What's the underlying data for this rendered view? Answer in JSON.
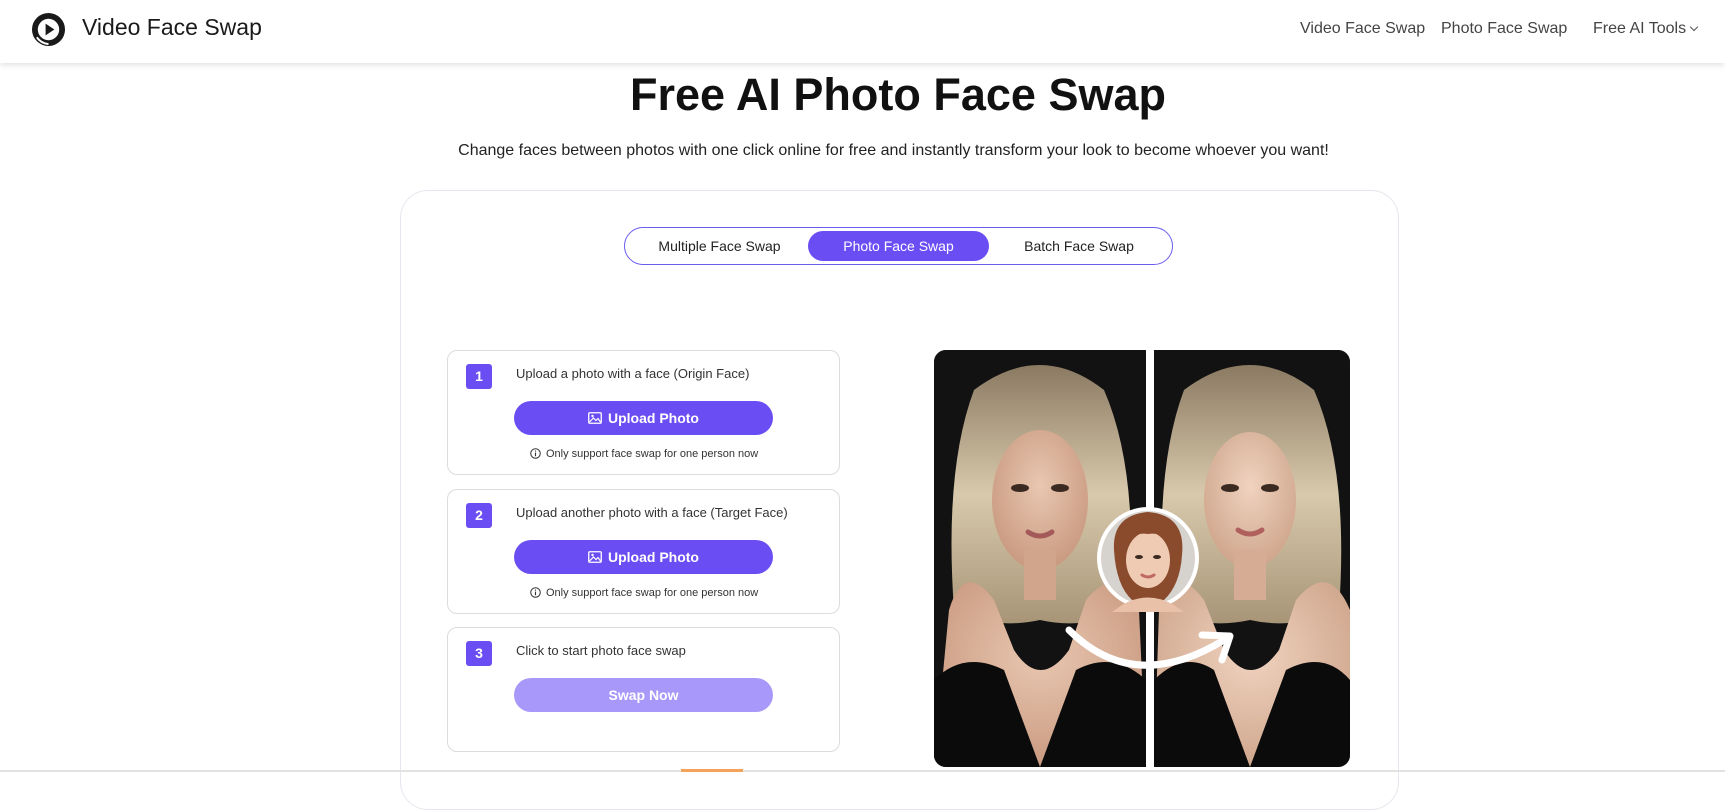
{
  "header": {
    "brand": "Video Face Swap",
    "nav": {
      "video_face_swap": "Video Face Swap",
      "photo_face_swap": "Photo Face Swap",
      "free_ai_tools": "Free AI Tools"
    }
  },
  "hero": {
    "title": "Free AI Photo Face Swap",
    "subtitle": "Change faces between photos with one click online for free and instantly transform your look to become whoever you want!"
  },
  "tabs": [
    {
      "label": "Multiple Face Swap",
      "active": false
    },
    {
      "label": "Photo Face Swap",
      "active": true
    },
    {
      "label": "Batch Face Swap",
      "active": false
    }
  ],
  "steps": [
    {
      "number": "1",
      "text": "Upload a photo with a face  (Origin Face)",
      "button": "Upload Photo",
      "note": "Only support face swap for one person now"
    },
    {
      "number": "2",
      "text": "Upload another photo with a face  (Target Face)",
      "button": "Upload Photo",
      "note": "Only support face swap for one person now"
    },
    {
      "number": "3",
      "text": "Click to start photo face swap",
      "button": "Swap Now"
    }
  ],
  "colors": {
    "accent": "#6b4ef3",
    "accent_disabled": "#a898f9"
  },
  "icons": {
    "logo": "play-logo-icon",
    "upload": "image-icon",
    "note": "info-icon",
    "dropdown": "chevron-down-icon",
    "swap_arrow": "curved-arrow-icon"
  }
}
